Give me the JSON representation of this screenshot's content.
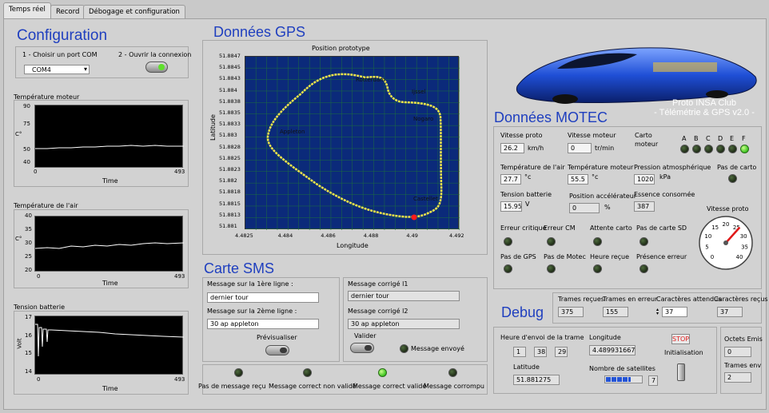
{
  "tabs": [
    "Temps réel",
    "Record",
    "Débogage et configuration"
  ],
  "config": {
    "title": "Configuration",
    "port_label": "1 - Choisir un port COM",
    "port_value": "COM4",
    "open_label": "2 - Ouvrir la connexion"
  },
  "charts": {
    "motor": {
      "title": "Température moteur",
      "ylabel": "C°",
      "xlabel": "Time",
      "yticks": [
        "90",
        "75",
        "50",
        "40"
      ],
      "xticks": [
        "0",
        "493"
      ]
    },
    "air": {
      "title": "Température de l'air",
      "ylabel": "C°",
      "xlabel": "Time",
      "yticks": [
        "40",
        "35",
        "30",
        "25",
        "20"
      ],
      "xticks": [
        "0",
        "493"
      ]
    },
    "batt": {
      "title": "Tension batterie",
      "ylabel": "Volt",
      "xlabel": "Time",
      "yticks": [
        "17",
        "16",
        "15",
        "14"
      ],
      "xticks": [
        "0",
        "493"
      ]
    }
  },
  "gps": {
    "title": "Données GPS",
    "plot_title": "Position prototype",
    "xlabel": "Longitude",
    "ylabel": "Latitude",
    "yticks": [
      "51.8847",
      "51.8845",
      "51.8843",
      "51.884",
      "51.8838",
      "51.8835",
      "51.8833",
      "51.883",
      "51.8828",
      "51.8825",
      "51.8823",
      "51.882",
      "51.8818",
      "51.8815",
      "51.8813",
      "51.881"
    ],
    "xticks": [
      "4.4825",
      "4.484",
      "4.486",
      "4.488",
      "4.49",
      "4.492"
    ],
    "places": [
      "Rotterdam",
      "Ijssel",
      "Nogaro",
      "Appleton",
      "Castellet"
    ]
  },
  "sms": {
    "title": "Carte SMS",
    "line1_label": "Message sur la 1ère ligne :",
    "line1_value": "dernier tour",
    "line2_label": "Message sur la 2ème ligne :",
    "line2_value": "30 ap appleton",
    "preview_label": "Prévisualiser",
    "c1_label": "Message corrigé l1",
    "c1_value": "dernier tour",
    "c2_label": "Message corrigé l2",
    "c2_value": "30 ap appleton",
    "validate_label": "Valider",
    "sent_label": "Message envoyé",
    "status": [
      "Pas de message reçu",
      "Message correct non validé",
      "Message correct validé",
      "Message corrompu"
    ]
  },
  "brand": {
    "line1": "Proto INSA Club",
    "line2": "- Télémétrie & GPS v2.0 -"
  },
  "motec": {
    "title": "Données MOTEC",
    "speed_label": "Vitesse proto",
    "speed_value": "26.2",
    "speed_unit": "km/h",
    "rpm_label": "Vitesse moteur",
    "rpm_value": "0",
    "rpm_unit": "tr/min",
    "carto_label1": "Carto",
    "carto_label2": "moteur",
    "carto_letters": [
      "A",
      "B",
      "C",
      "D",
      "E",
      "F"
    ],
    "airtemp_label": "Température de l'air",
    "airtemp_value": "27.7",
    "airtemp_unit": "°c",
    "motortemp_label": "Température moteur",
    "motortemp_value": "55.5",
    "motortemp_unit": "°c",
    "pressure_label": "Pression atmosphérique",
    "pressure_value": "1020",
    "pressure_unit": "kPa",
    "nocarto_label": "Pas de carto",
    "batt_label": "Tension batterie",
    "batt_value": "15.95",
    "batt_unit": "V",
    "throttle_label": "Position accélérateur",
    "throttle_value": "0",
    "throttle_unit": "%",
    "fuel_label": "Essence consomée",
    "fuel_value": "387",
    "gauge_label": "Vitesse proto",
    "gauge_ticks": [
      "0",
      "5",
      "10",
      "15",
      "20",
      "25",
      "30",
      "35",
      "40"
    ],
    "gauge_value": 26.2,
    "flags1": [
      "Erreur critique",
      "Erreur CM",
      "Attente carto",
      "Pas de carte SD"
    ],
    "flags2": [
      "Pas de GPS",
      "Pas de Motec",
      "Heure reçue",
      "Présence erreur"
    ]
  },
  "debug": {
    "title": "Debug",
    "recv_label": "Trames reçues",
    "recv_value": "375",
    "err_label": "Trames en erreur",
    "err_value": "155",
    "expected_label": "Caractères attendus",
    "expected_value": "37",
    "chars_label": "Caractères reçus",
    "chars_value": "37",
    "time_label": "Heure d'envoi de la trame",
    "time_h": "1",
    "time_m": "38",
    "time_s": "29",
    "lon_label": "Longitude",
    "lon_value": "4.489931667",
    "stop_label": "STOP",
    "init_label": "Initialisation",
    "lat_label": "Latitude",
    "lat_value": "51.881275",
    "sat_label": "Nombre de satellites",
    "sat_value": "7",
    "bytes_label": "Octets Emis",
    "bytes_value": "0",
    "sent_label": "Trames env",
    "sent_value": "2"
  }
}
